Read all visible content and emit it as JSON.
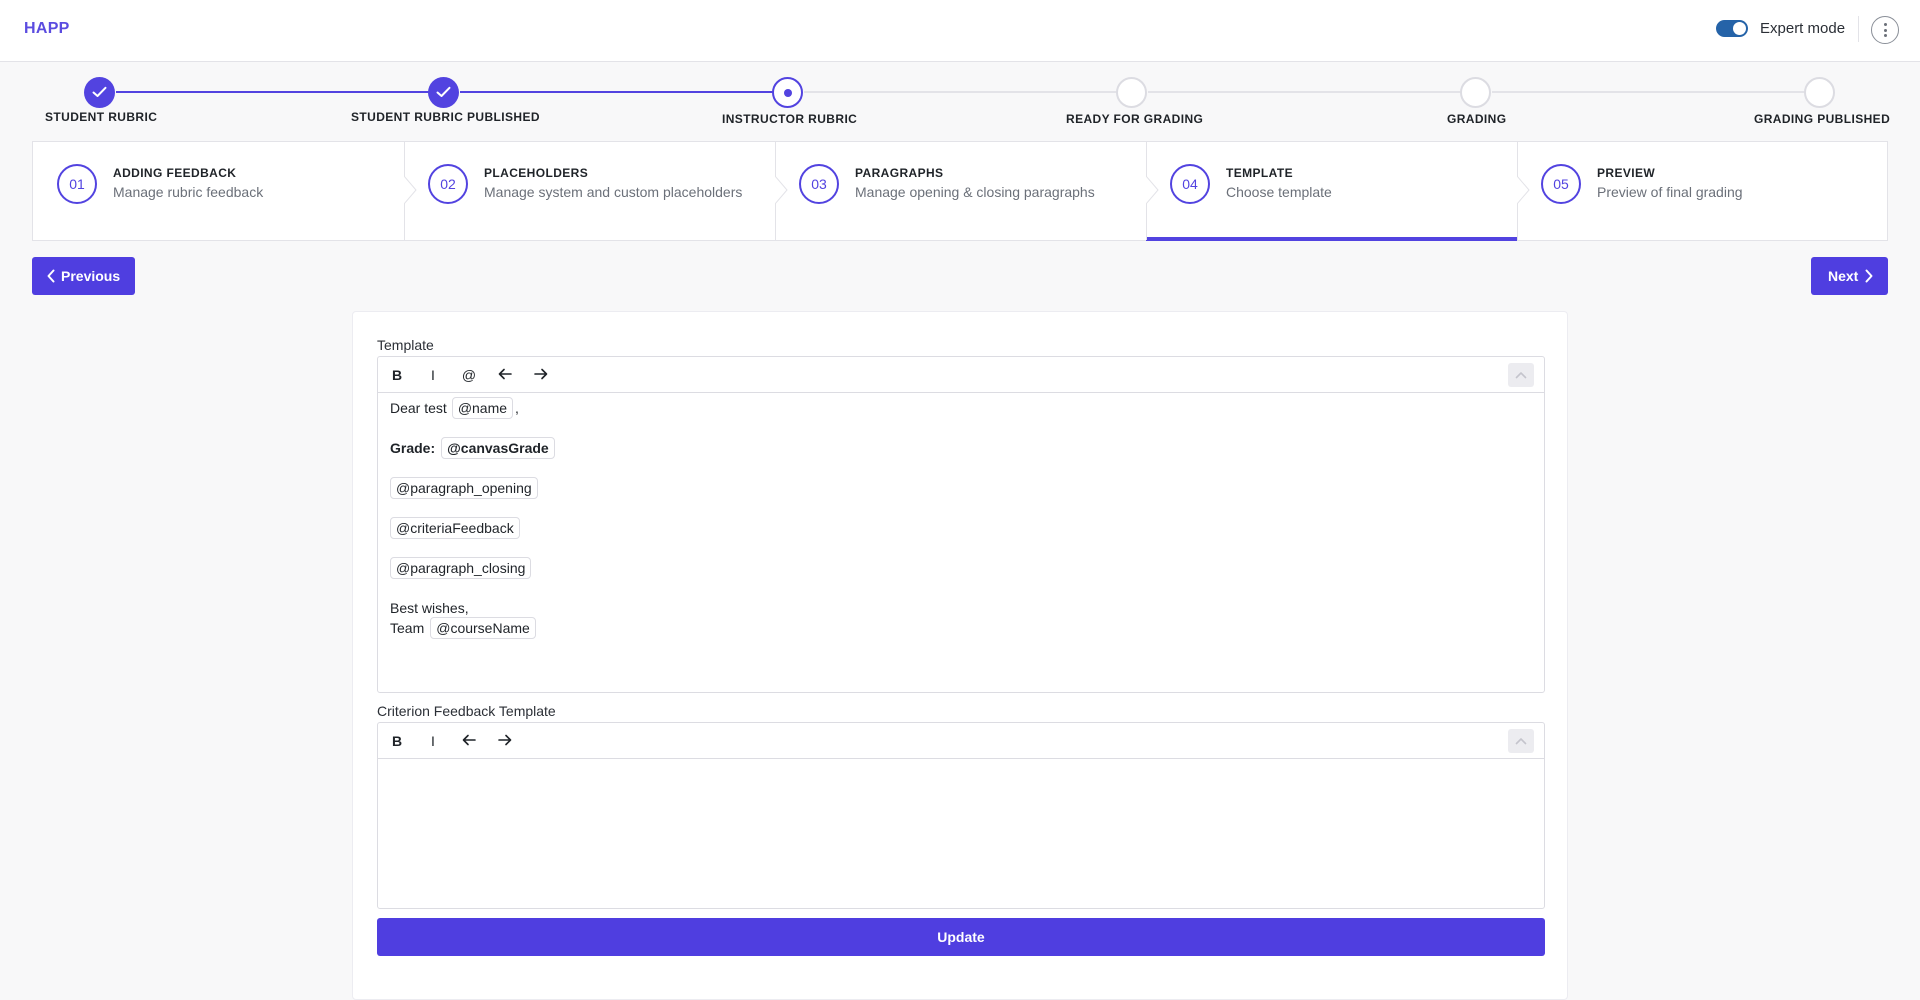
{
  "app": {
    "brand": "HAPP",
    "expert_mode_label": "Expert mode",
    "expert_mode_on": true
  },
  "progress": {
    "steps": [
      {
        "label": "STUDENT RUBRIC",
        "status": "done"
      },
      {
        "label": "STUDENT RUBRIC PUBLISHED",
        "status": "done"
      },
      {
        "label": "INSTRUCTOR RUBRIC",
        "status": "current"
      },
      {
        "label": "READY FOR GRADING",
        "status": "todo"
      },
      {
        "label": "GRADING",
        "status": "todo"
      },
      {
        "label": "GRADING PUBLISHED",
        "status": "todo"
      }
    ]
  },
  "tabs": [
    {
      "num": "01",
      "title": "ADDING FEEDBACK",
      "sub": "Manage rubric feedback"
    },
    {
      "num": "02",
      "title": "PLACEHOLDERS",
      "sub": "Manage system and custom placeholders"
    },
    {
      "num": "03",
      "title": "PARAGRAPHS",
      "sub": "Manage opening & closing paragraphs"
    },
    {
      "num": "04",
      "title": "TEMPLATE",
      "sub": "Choose template",
      "active": true
    },
    {
      "num": "05",
      "title": "PREVIEW",
      "sub": "Preview of final grading"
    }
  ],
  "nav": {
    "previous": "Previous",
    "next": "Next"
  },
  "template_editor": {
    "label": "Template",
    "toolbar": {
      "bold": "B",
      "italic": "I",
      "mention": "@"
    },
    "content": {
      "greeting_prefix": "Dear test",
      "greeting_name": "@name",
      "greeting_suffix": ",",
      "grade_label": "Grade:",
      "grade_value": "@canvasGrade",
      "opening": "@paragraph_opening",
      "criteria": "@criteriaFeedback",
      "closing": "@paragraph_closing",
      "signoff": "Best wishes,",
      "team_prefix": "Team",
      "team_value": "@courseName"
    }
  },
  "criterion_editor": {
    "label": "Criterion Feedback Template",
    "toolbar": {
      "bold": "B",
      "italic": "I"
    }
  },
  "update_button": "Update",
  "colors": {
    "accent": "#5243e0",
    "toggle": "#2563a8"
  }
}
